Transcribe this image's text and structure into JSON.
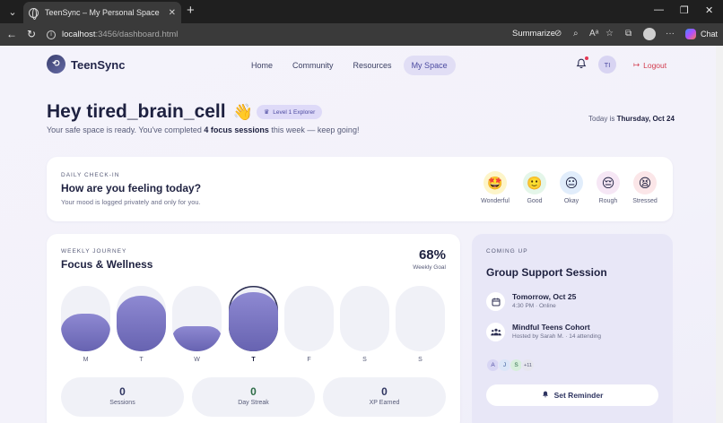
{
  "browser": {
    "tab_title": "TeenSync – My Personal Space",
    "url_host": "localhost",
    "url_rest": ":3456/dashboard.html",
    "summarize_label": "Summarize",
    "chat_label": "Chat"
  },
  "header": {
    "logo_text": "TeenSync",
    "nav": [
      "Home",
      "Community",
      "Resources",
      "My Space"
    ],
    "active_nav": "My Space",
    "avatar_initials": "TI",
    "logout_label": "Logout"
  },
  "greeting": {
    "title": "Hey tired_brain_cell",
    "emoji": "👋",
    "badge": "Level 1 Explorer",
    "sub_prefix": "Your safe space is ready. You've completed ",
    "sub_bold": "4 focus sessions",
    "sub_suffix": " this week — keep going!",
    "today_prefix": "Today is ",
    "today_date": "Thursday, Oct 24"
  },
  "checkin": {
    "eyebrow": "DAILY CHECK-IN",
    "question": "How are you feeling today?",
    "note": "Your mood is logged privately and only for you.",
    "moods": [
      {
        "label": "Wonderful",
        "emoji": "🤩",
        "bg": "#fdf5c9"
      },
      {
        "label": "Good",
        "emoji": "🙂",
        "bg": "#e4f6e9"
      },
      {
        "label": "Okay",
        "emoji": "😐",
        "bg": "#e1edfb"
      },
      {
        "label": "Rough",
        "emoji": "😔",
        "bg": "#f6e7f5"
      },
      {
        "label": "Stressed",
        "emoji": "😫",
        "bg": "#fbe6e8"
      }
    ]
  },
  "journey": {
    "eyebrow": "WEEKLY JOURNEY",
    "title": "Focus & Wellness",
    "goal_pct": "68%",
    "goal_label": "Weekly Goal",
    "days": [
      {
        "label": "M",
        "level": 0.58
      },
      {
        "label": "T",
        "level": 0.85
      },
      {
        "label": "W",
        "level": 0.38
      },
      {
        "label": "T",
        "level": 0.9,
        "today": true
      },
      {
        "label": "F",
        "level": 0
      },
      {
        "label": "S",
        "level": 0
      },
      {
        "label": "S",
        "level": 0
      }
    ],
    "stats": [
      {
        "value": "0",
        "label": "Sessions"
      },
      {
        "value": "0",
        "label": "Day Streak",
        "accent": true
      },
      {
        "value": "0",
        "label": "XP Earned"
      }
    ]
  },
  "coming_up": {
    "eyebrow": "COMING UP",
    "title": "Group Support Session",
    "events": [
      {
        "line1": "Tomorrow, Oct 25",
        "line2": "4:30 PM · Online"
      },
      {
        "line1": "Mindful Teens Cohort",
        "line2": "Hosted by Sarah M. · 14 attending"
      }
    ],
    "attendees": [
      "A",
      "J",
      "S",
      "+11"
    ],
    "reminder_label": "Set Reminder"
  }
}
